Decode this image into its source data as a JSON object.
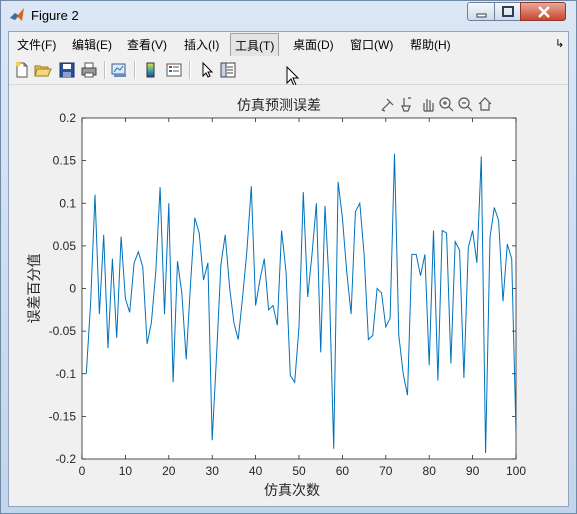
{
  "window": {
    "title": "Figure 2"
  },
  "menu": [
    {
      "label": "文件(F)"
    },
    {
      "label": "编辑(E)"
    },
    {
      "label": "查看(V)"
    },
    {
      "label": "插入(I)"
    },
    {
      "label": "工具(T)"
    },
    {
      "label": "桌面(D)"
    },
    {
      "label": "窗口(W)"
    },
    {
      "label": "帮助(H)"
    }
  ],
  "toolbar": [
    "new-figure-icon",
    "open-file-icon",
    "save-icon",
    "print-icon",
    "link-plot-icon",
    "colorbar-icon",
    "legend-icon",
    "edit-plot-arrow-icon",
    "property-inspector-icon"
  ],
  "axes_toolbar": [
    "brush-icon",
    "data-cursor-icon",
    "pan-icon",
    "zoom-in-icon",
    "zoom-out-icon",
    "home-icon"
  ],
  "colors": {
    "line": "#0072bd",
    "axes_bg": "#ffffff",
    "figure_bg": "#f0f0f0"
  },
  "chart_data": {
    "type": "line",
    "title": "仿真预测误差",
    "xlabel": "仿真次数",
    "ylabel": "误差百分值",
    "xlim": [
      0,
      100
    ],
    "ylim": [
      -0.2,
      0.2
    ],
    "xticks": [
      0,
      10,
      20,
      30,
      40,
      50,
      60,
      70,
      80,
      90,
      100
    ],
    "yticks": [
      -0.2,
      -0.15,
      -0.1,
      -0.05,
      0,
      0.05,
      0.1,
      0.15,
      0.2
    ],
    "ytick_labels": [
      "-0.2",
      "-0.15",
      "-0.1",
      "-0.05",
      "0",
      "0.05",
      "0.1",
      "0.15",
      "0.2"
    ],
    "grid": false,
    "series": [
      {
        "x": [
          1,
          2,
          3,
          4,
          5,
          6,
          7,
          8,
          9,
          10,
          11,
          12,
          13,
          14,
          15,
          16,
          17,
          18,
          19,
          20,
          21,
          22,
          23,
          24,
          25,
          26,
          27,
          28,
          29,
          30,
          31,
          32,
          33,
          34,
          35,
          36,
          37,
          38,
          39,
          40,
          41,
          42,
          43,
          44,
          45,
          46,
          47,
          48,
          49,
          50,
          51,
          52,
          53,
          54,
          55,
          56,
          57,
          58,
          59,
          60,
          61,
          62,
          63,
          64,
          65,
          66,
          67,
          68,
          69,
          70,
          71,
          72,
          73,
          74,
          75,
          76,
          77,
          78,
          79,
          80,
          81,
          82,
          83,
          84,
          85,
          86,
          87,
          88,
          89,
          90,
          91,
          92,
          93,
          94,
          95,
          96,
          97,
          98,
          99,
          100
        ],
        "y": [
          -0.1,
          -0.015,
          0.11,
          -0.03,
          0.063,
          -0.07,
          0.035,
          -0.058,
          0.061,
          -0.012,
          -0.028,
          0.03,
          0.043,
          0.025,
          -0.065,
          -0.04,
          0.02,
          0.119,
          -0.03,
          0.1,
          -0.11,
          0.032,
          -0.005,
          -0.083,
          0.005,
          0.083,
          0.065,
          0.01,
          0.03,
          -0.178,
          -0.08,
          0.028,
          0.063,
          0.001,
          -0.04,
          -0.06,
          -0.01,
          0.044,
          0.12,
          -0.02,
          0.01,
          0.035,
          -0.025,
          -0.02,
          -0.043,
          0.068,
          0.02,
          -0.102,
          -0.11,
          -0.045,
          0.113,
          -0.01,
          0.04,
          0.1,
          -0.075,
          0.097,
          0.0,
          -0.188,
          0.125,
          0.083,
          0.02,
          -0.03,
          0.09,
          0.1,
          0.04,
          -0.06,
          -0.055,
          0.0,
          -0.005,
          -0.045,
          -0.035,
          0.158,
          -0.055,
          -0.1,
          -0.125,
          0.04,
          0.04,
          0.015,
          0.04,
          -0.09,
          0.068,
          -0.108,
          0.068,
          0.065,
          -0.088,
          0.055,
          0.045,
          -0.105,
          0.048,
          0.068,
          0.03,
          0.155,
          -0.193,
          0.06,
          0.095,
          0.08,
          -0.015,
          0.052,
          0.035,
          -0.17
        ]
      }
    ]
  }
}
